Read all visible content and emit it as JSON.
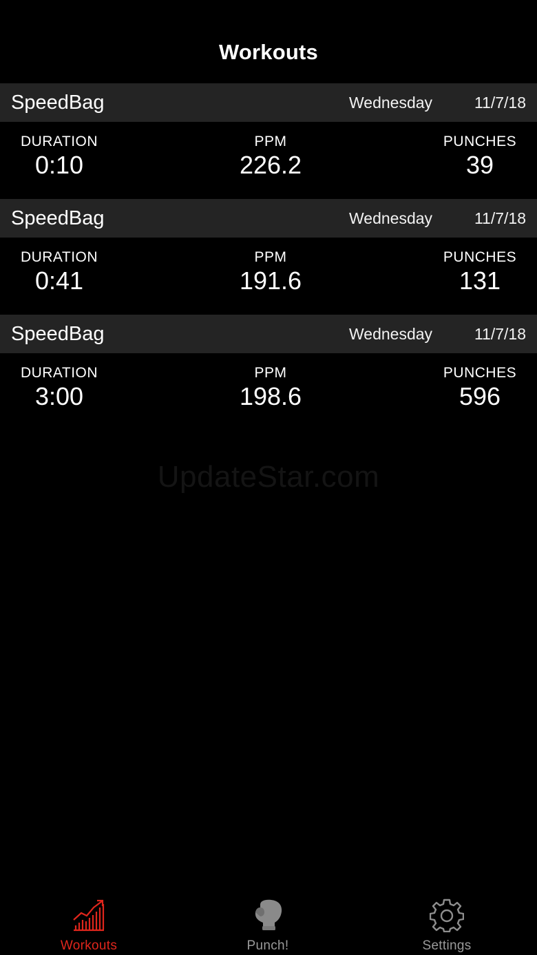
{
  "header": {
    "title": "Workouts"
  },
  "workouts": [
    {
      "name": "SpeedBag",
      "day": "Wednesday",
      "date": "11/7/18",
      "stats": {
        "duration_label": "DURATION",
        "duration": "0:10",
        "ppm_label": "PPM",
        "ppm": "226.2",
        "punches_label": "PUNCHES",
        "punches": "39"
      }
    },
    {
      "name": "SpeedBag",
      "day": "Wednesday",
      "date": "11/7/18",
      "stats": {
        "duration_label": "DURATION",
        "duration": "0:41",
        "ppm_label": "PPM",
        "ppm": "191.6",
        "punches_label": "PUNCHES",
        "punches": "131"
      }
    },
    {
      "name": "SpeedBag",
      "day": "Wednesday",
      "date": "11/7/18",
      "stats": {
        "duration_label": "DURATION",
        "duration": "3:00",
        "ppm_label": "PPM",
        "ppm": "198.6",
        "punches_label": "PUNCHES",
        "punches": "596"
      }
    }
  ],
  "watermark": "UpdateStar.com",
  "tabbar": {
    "items": [
      {
        "label": "Workouts",
        "icon": "chart-growth-icon",
        "active": true
      },
      {
        "label": "Punch!",
        "icon": "boxing-glove-icon",
        "active": false
      },
      {
        "label": "Settings",
        "icon": "gear-icon",
        "active": false
      }
    ]
  },
  "colors": {
    "background": "#000000",
    "section_header": "#242424",
    "accent": "#e0261c",
    "inactive_tab": "#9a9a9a",
    "text": "#ffffff"
  }
}
